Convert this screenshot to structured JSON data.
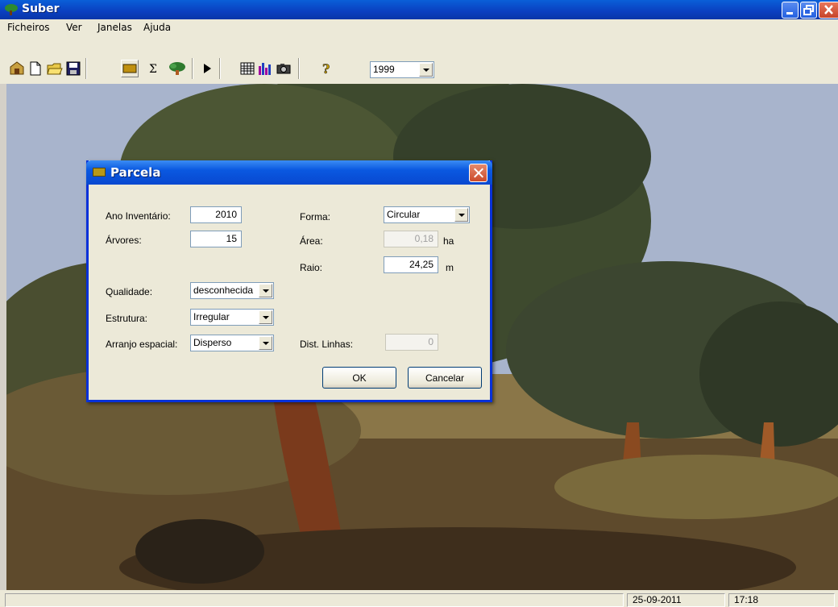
{
  "window": {
    "title": "Suber"
  },
  "menu": [
    "Ficheiros",
    "Ver",
    "Janelas",
    "Ajuda"
  ],
  "toolbar": {
    "year": "1999",
    "icons": [
      "open-plot-icon",
      "new-file-icon",
      "open-folder-icon",
      "save-icon",
      "plot-icon",
      "sum-icon",
      "tree-icon",
      "play-icon",
      "table-icon",
      "chart-icon",
      "camera-icon",
      "help-icon"
    ]
  },
  "dialog": {
    "title": "Parcela",
    "ano_label": "Ano Inventário:",
    "ano_value": "2010",
    "arvores_label": "Árvores:",
    "arvores_value": "15",
    "forma_label": "Forma:",
    "forma_value": "Circular",
    "area_label": "Área:",
    "area_value": "0,18",
    "area_unit": "ha",
    "raio_label": "Raio:",
    "raio_value": "24,25",
    "raio_unit": "m",
    "qualidade_label": "Qualidade:",
    "qualidade_value": "desconhecida",
    "estrutura_label": "Estrutura:",
    "estrutura_value": "Irregular",
    "arranjo_label": "Arranjo espacial:",
    "arranjo_value": "Disperso",
    "dist_label": "Dist. Linhas:",
    "dist_value": "0",
    "ok_label": "OK",
    "cancel_label": "Cancelar"
  },
  "status": {
    "date": "25-09-2011",
    "time": "17:18"
  },
  "colors": {
    "title_blue": "#0a3fc0",
    "dialog_border": "#0831d9",
    "face": "#ece9d8"
  }
}
